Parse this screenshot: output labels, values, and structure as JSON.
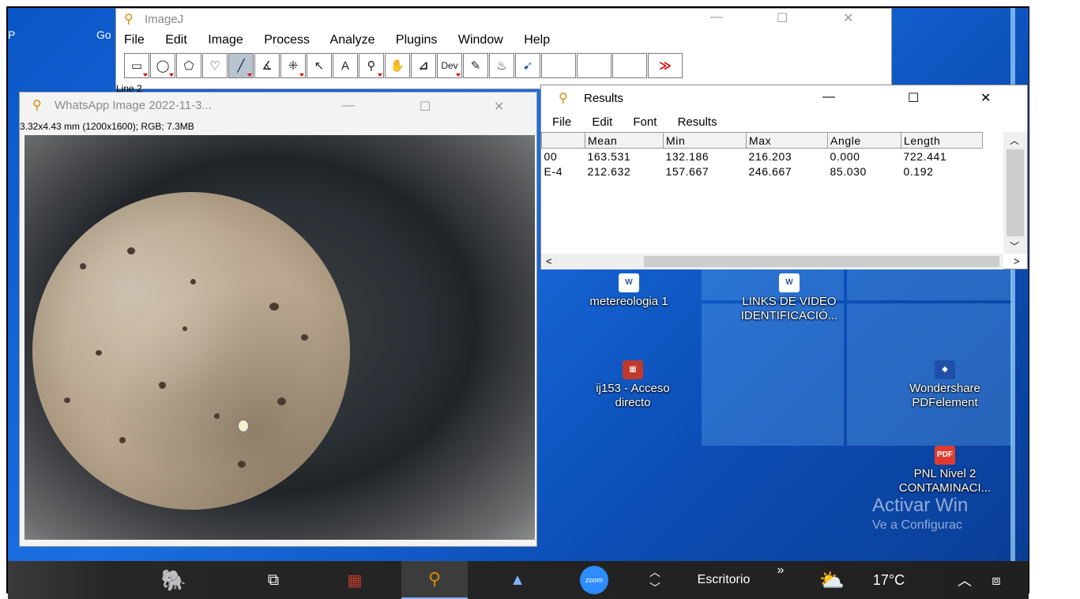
{
  "imagej": {
    "title": "ImageJ",
    "menu": [
      "File",
      "Edit",
      "Image",
      "Process",
      "Analyze",
      "Plugins",
      "Window",
      "Help"
    ],
    "status": "Line 2",
    "dev_label": "Dev",
    "more_label": "≫"
  },
  "image_window": {
    "title": "WhatsApp Image 2022-11-3...",
    "info": "3.32x4.43 mm (1200x1600); RGB; 7.3MB"
  },
  "results": {
    "title": "Results",
    "menu": [
      "File",
      "Edit",
      "Font",
      "Results"
    ],
    "columns": [
      "",
      "Mean",
      "Min",
      "Max",
      "Angle",
      "Length"
    ],
    "rows": [
      [
        "00",
        "163.531",
        "132.186",
        "216.203",
        "0.000",
        "722.441"
      ],
      [
        "E-4",
        "212.632",
        "157.667",
        "246.667",
        "85.030",
        "0.192"
      ]
    ]
  },
  "left_fragments": {
    "a": "P",
    "b": "Go"
  },
  "desktop_icons": [
    {
      "name": "metereologia-icon",
      "label1": "metereologia 1",
      "label2": ""
    },
    {
      "name": "links-video-icon",
      "label1": "LINKS DE VIDEO",
      "label2": "IDENTIFICACIÓ..."
    },
    {
      "name": "ij153-icon",
      "label1": "ij153 - Acceso",
      "label2": "directo"
    },
    {
      "name": "wondershare-icon",
      "label1": "Wondershare",
      "label2": "PDFelement"
    },
    {
      "name": "pnl-pdf-icon",
      "label1": "PNL Nivel 2",
      "label2": "CONTAMINACI..."
    }
  ],
  "watermark": {
    "line1": "Activar Win",
    "line2": "Ve a Configurac"
  },
  "icon_badges": {
    "word": "W",
    "pdf": "PDF"
  },
  "taskbar": {
    "desktop_label": "Escritorio",
    "chevron": "»",
    "temperature": "17°C",
    "zoom_label": "zoom"
  },
  "colors": {
    "desktop_blue": "#0a56c7",
    "accent_red": "#d00000"
  }
}
